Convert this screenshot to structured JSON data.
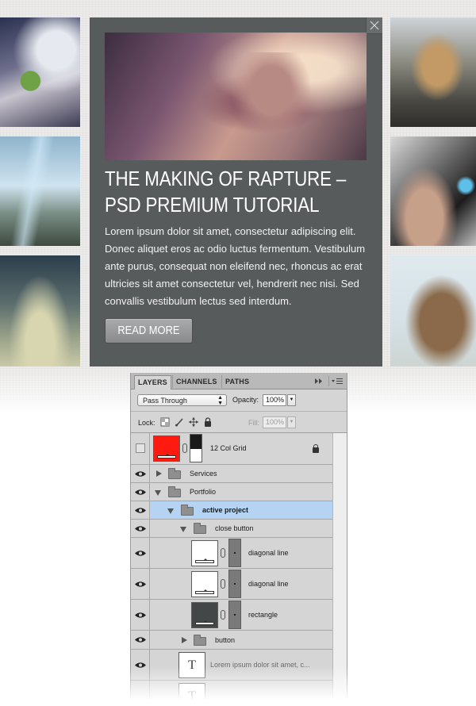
{
  "article": {
    "title": "The Making of Rapture – PSD Premium Tutorial",
    "body": "Lorem ipsum dolor sit amet, consectetur adipiscing elit. Donec aliquet eros ac odio luctus fermentum. Vestibulum ante purus, consequat non eleifend nec, rhoncus ac erat ultricies sit amet consectetur vel, hendrerit nec nisi. Sed convallis vestibulum lectus sed interdum.",
    "read_more_label": "Read More",
    "close_icon": "close-x-icon"
  },
  "layers_panel": {
    "tabs": [
      {
        "label": "LAYERS",
        "active": true
      },
      {
        "label": "CHANNELS",
        "active": false
      },
      {
        "label": "PATHS",
        "active": false
      }
    ],
    "blend_mode": "Pass Through",
    "opacity_label": "Opacity:",
    "opacity_value": "100%",
    "lock_label": "Lock:",
    "fill_label": "Fill:",
    "fill_value": "100%",
    "layers": [
      {
        "name": "12 Col Grid",
        "visible": false,
        "type": "shape-with-mask",
        "color": "#ff1a10",
        "locked": true
      },
      {
        "name": "Services",
        "visible": true,
        "type": "group",
        "expanded": false
      },
      {
        "name": "Portfolio",
        "visible": true,
        "type": "group",
        "expanded": true
      },
      {
        "name": "active project",
        "visible": true,
        "type": "group",
        "expanded": true,
        "selected": true
      },
      {
        "name": "close button",
        "visible": true,
        "type": "group",
        "expanded": true
      },
      {
        "name": "diagonal line",
        "visible": true,
        "type": "shape-with-mask",
        "color": "#ffffff"
      },
      {
        "name": "diagonal line",
        "visible": true,
        "type": "shape-with-mask",
        "color": "#ffffff"
      },
      {
        "name": "rectangle",
        "visible": true,
        "type": "shape-with-mask",
        "color": "#444748"
      },
      {
        "name": "button",
        "visible": true,
        "type": "group",
        "expanded": false
      },
      {
        "name": "Lorem ipsum dolor sit amet, c...",
        "visible": true,
        "type": "text"
      }
    ]
  },
  "colors": {
    "panel_bg": "#585b5c",
    "selected_layer": "#b5d4f4",
    "grid_swatch": "#ff1a10"
  }
}
